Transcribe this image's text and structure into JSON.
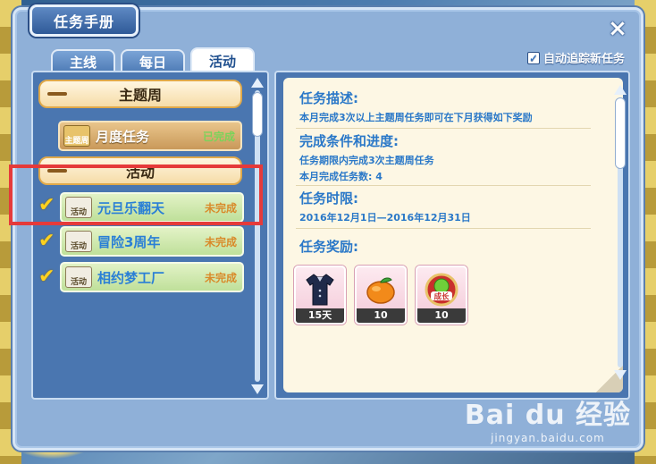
{
  "window": {
    "title": "任务手册",
    "close_icon": "×"
  },
  "tabs": [
    {
      "label": "主线",
      "active": false
    },
    {
      "label": "每日",
      "active": false
    },
    {
      "label": "活动",
      "active": true
    }
  ],
  "auto_track": {
    "label": "自动追踪新任务",
    "checked": true
  },
  "task_list": {
    "groups": [
      {
        "title": "主题周"
      },
      {
        "title": "活动"
      }
    ],
    "tasks": [
      {
        "tag": "主题周",
        "name": "月度任务",
        "status": "已完成",
        "checked": false
      },
      {
        "tag": "活动",
        "name": "元旦乐翻天",
        "status": "未完成",
        "checked": true
      },
      {
        "tag": "活动",
        "name": "冒险3周年",
        "status": "未完成",
        "checked": true
      },
      {
        "tag": "活动",
        "name": "相约梦工厂",
        "status": "未完成",
        "checked": true
      }
    ]
  },
  "details": {
    "description": {
      "title": "任务描述:",
      "text": "本月完成3次以上主题周任务即可在下月获得如下奖励"
    },
    "conditions": {
      "title": "完成条件和进度:",
      "line1": "任务期限内完成3次主题周任务",
      "line2": "本月完成任务数: 4"
    },
    "time_limit": {
      "title": "任务时限:",
      "text": "2016年12月1日—2016年12月31日"
    },
    "rewards": {
      "title": "任务奖励:",
      "items": [
        {
          "icon": "shirt-icon",
          "qty": "15天"
        },
        {
          "icon": "orange-icon",
          "qty": "10"
        },
        {
          "icon": "growth-badge-icon",
          "label": "成长",
          "qty": "10"
        }
      ]
    }
  },
  "watermark": {
    "logo": "Bai du 经验",
    "url": "jingyan.baidu.com"
  },
  "colors": {
    "accent": "#2a78c8",
    "highlight": "#e53a3a",
    "done": "#7ad35a",
    "pending": "#d98a2a"
  }
}
